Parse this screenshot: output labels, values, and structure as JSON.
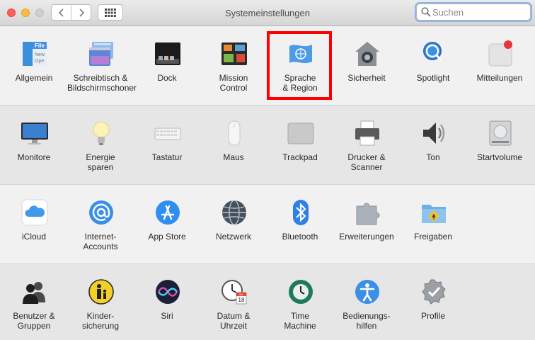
{
  "window": {
    "title": "Systemeinstellungen",
    "search_placeholder": "Suchen"
  },
  "rows": [
    [
      {
        "name": "allgemein",
        "label": "Allgemein",
        "icon": "general-icon"
      },
      {
        "name": "schreibtisch",
        "label": "Schreibtisch &\nBildschirmschoner",
        "icon": "desktop-screensaver-icon"
      },
      {
        "name": "dock",
        "label": "Dock",
        "icon": "dock-icon"
      },
      {
        "name": "mission-control",
        "label": "Mission\nControl",
        "icon": "mission-control-icon"
      },
      {
        "name": "sprache-region",
        "label": "Sprache\n& Region",
        "icon": "un-flag-icon"
      },
      {
        "name": "sicherheit",
        "label": "Sicherheit",
        "icon": "house-safe-icon"
      },
      {
        "name": "spotlight",
        "label": "Spotlight",
        "icon": "magnifier-icon"
      },
      {
        "name": "mitteilungen",
        "label": "Mitteilungen",
        "icon": "notifications-icon"
      }
    ],
    [
      {
        "name": "monitore",
        "label": "Monitore",
        "icon": "display-icon"
      },
      {
        "name": "energie-sparen",
        "label": "Energie\nsparen",
        "icon": "lightbulb-icon"
      },
      {
        "name": "tastatur",
        "label": "Tastatur",
        "icon": "keyboard-icon"
      },
      {
        "name": "maus",
        "label": "Maus",
        "icon": "mouse-icon"
      },
      {
        "name": "trackpad",
        "label": "Trackpad",
        "icon": "trackpad-icon"
      },
      {
        "name": "drucker-scanner",
        "label": "Drucker &\nScanner",
        "icon": "printer-icon"
      },
      {
        "name": "ton",
        "label": "Ton",
        "icon": "speaker-icon"
      },
      {
        "name": "startvolume",
        "label": "Startvolume",
        "icon": "hard-drive-icon"
      }
    ],
    [
      {
        "name": "icloud",
        "label": "iCloud",
        "icon": "cloud-icon"
      },
      {
        "name": "internet-accounts",
        "label": "Internet-\nAccounts",
        "icon": "at-sign-icon"
      },
      {
        "name": "app-store",
        "label": "App Store",
        "icon": "app-store-icon"
      },
      {
        "name": "netzwerk",
        "label": "Netzwerk",
        "icon": "globe-icon"
      },
      {
        "name": "bluetooth",
        "label": "Bluetooth",
        "icon": "bluetooth-icon"
      },
      {
        "name": "erweiterungen",
        "label": "Erweiterungen",
        "icon": "puzzle-icon"
      },
      {
        "name": "freigaben",
        "label": "Freigaben",
        "icon": "shared-folder-icon"
      }
    ],
    [
      {
        "name": "benutzer-gruppen",
        "label": "Benutzer &\nGruppen",
        "icon": "users-icon"
      },
      {
        "name": "kindersicherung",
        "label": "Kinder-\nsicherung",
        "icon": "parental-controls-icon"
      },
      {
        "name": "siri",
        "label": "Siri",
        "icon": "siri-icon"
      },
      {
        "name": "datum-uhrzeit",
        "label": "Datum &\nUhrzeit",
        "icon": "clock-calendar-icon"
      },
      {
        "name": "time-machine",
        "label": "Time\nMachine",
        "icon": "time-machine-icon"
      },
      {
        "name": "bedienungshilfen",
        "label": "Bedienungs-\nhilfen",
        "icon": "accessibility-icon"
      },
      {
        "name": "profile",
        "label": "Profile",
        "icon": "badge-check-icon"
      }
    ]
  ],
  "calendar": {
    "month": "JUL",
    "day": "18"
  },
  "general_icon_text": [
    "File",
    "New",
    "Ope"
  ],
  "highlight": {
    "target": "sprache-region",
    "color": "#ff0000"
  }
}
